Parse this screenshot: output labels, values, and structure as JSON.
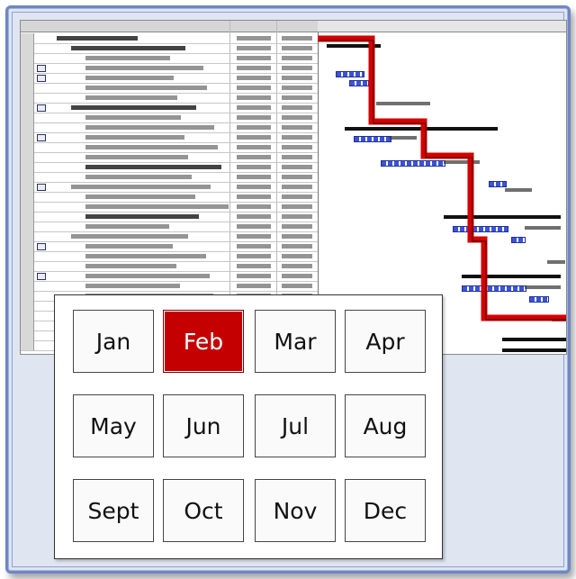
{
  "month_picker": {
    "selected": "Feb",
    "months": [
      "Jan",
      "Feb",
      "Mar",
      "Apr",
      "May",
      "Jun",
      "Jul",
      "Aug",
      "Sept",
      "Oct",
      "Nov",
      "Dec"
    ]
  },
  "colors": {
    "selected_bg": "#c40000",
    "selected_text": "#ffffff",
    "critical_path": "#d40000",
    "task_bar": "#3a55d9",
    "frame": "#6e86c4"
  }
}
